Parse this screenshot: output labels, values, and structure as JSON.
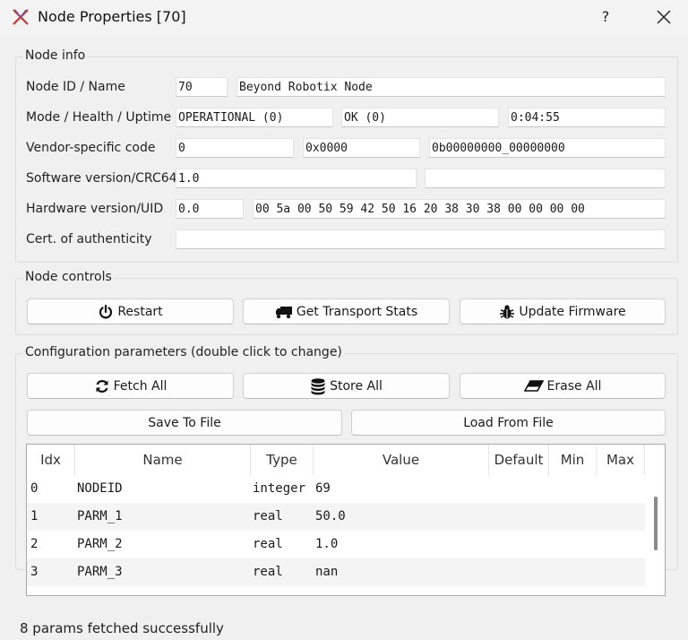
{
  "window": {
    "title": "Node Properties [70]",
    "help": "?"
  },
  "node_info": {
    "title": "Node info",
    "rows": [
      {
        "label": "Node ID / Name",
        "values": [
          "70",
          "Beyond Robotix Node"
        ]
      },
      {
        "label": "Mode / Health / Uptime",
        "values": [
          "OPERATIONAL (0)",
          "OK (0)",
          "0:04:55"
        ]
      },
      {
        "label": "Vendor-specific code",
        "values": [
          "0",
          "0x0000",
          "0b00000000_00000000"
        ]
      },
      {
        "label": "Software version/CRC64",
        "values": [
          "1.0",
          ""
        ]
      },
      {
        "label": "Hardware version/UID",
        "values": [
          "0.0",
          "00 5a 00 50 59 42 50 16 20 38 30 38 00 00 00 00"
        ]
      },
      {
        "label": "Cert. of authenticity",
        "values": [
          ""
        ]
      }
    ]
  },
  "node_controls": {
    "title": "Node controls",
    "restart": "Restart",
    "transport": "Get Transport Stats",
    "firmware": "Update Firmware"
  },
  "config": {
    "title": "Configuration parameters (double click to change)",
    "fetch": "Fetch All",
    "store": "Store All",
    "erase": "Erase All",
    "save": "Save To File",
    "load": "Load From File",
    "columns": [
      "Idx",
      "Name",
      "Type",
      "Value",
      "Default",
      "Min",
      "Max"
    ],
    "rows": [
      {
        "idx": "0",
        "name": "NODEID",
        "type": "integer",
        "value": "69"
      },
      {
        "idx": "1",
        "name": "PARM_1",
        "type": "real",
        "value": "50.0"
      },
      {
        "idx": "2",
        "name": "PARM_2",
        "type": "real",
        "value": "1.0"
      },
      {
        "idx": "3",
        "name": "PARM_3",
        "type": "real",
        "value": "nan"
      }
    ]
  },
  "status": "8 params fetched successfully",
  "colors": {
    "app_icon": "#c0392b",
    "row_alt": "#f4f4f4",
    "window_bg": "#f0f0f0"
  }
}
